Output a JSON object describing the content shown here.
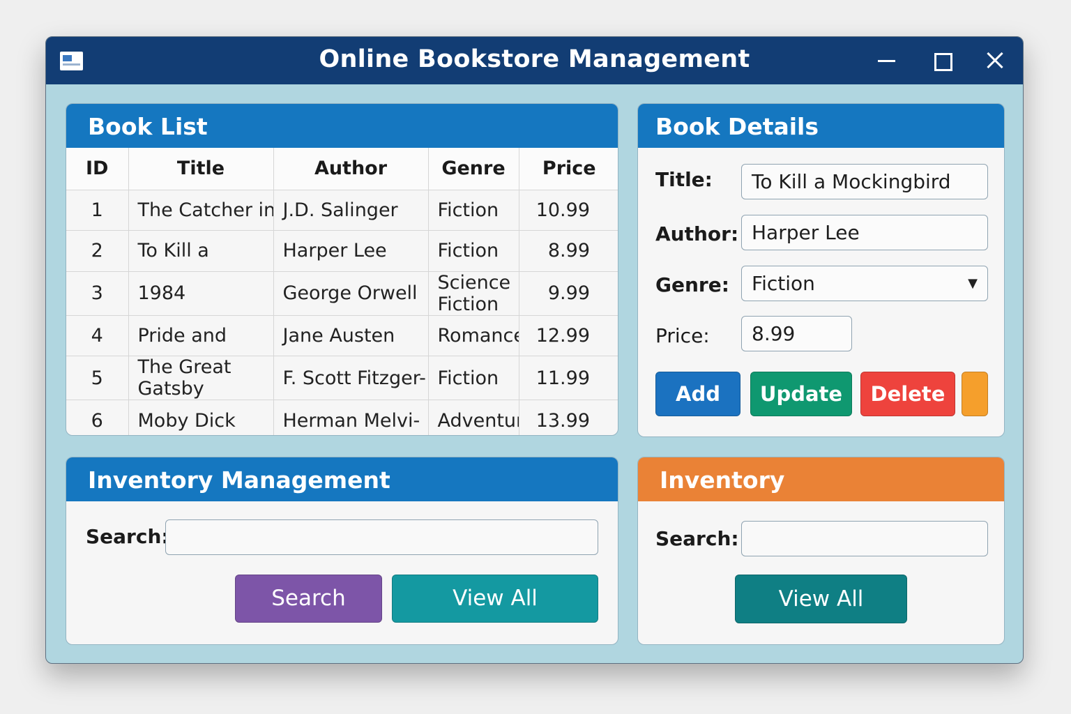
{
  "window": {
    "title": "Online Bookstore Management",
    "icons": {
      "app": "app-window-icon",
      "minimize": "minimize-icon",
      "maximize": "maximize-icon",
      "close": "close-icon"
    }
  },
  "book_list": {
    "header": "Book List",
    "columns": [
      "ID",
      "Title",
      "Author",
      "Genre",
      "Price"
    ],
    "rows": [
      {
        "id": "1",
        "title": "The Catcher in",
        "author": "J.D. Salinger",
        "genre": "Fiction",
        "price": "10.99"
      },
      {
        "id": "2",
        "title": "To Kill a",
        "author": "Harper Lee",
        "genre": "Fiction",
        "price": "8.99"
      },
      {
        "id": "3",
        "title": "1984",
        "author": "George Orwell",
        "genre": "Science Fiction",
        "price": "9.99"
      },
      {
        "id": "4",
        "title": "Pride and",
        "author": "Jane Austen",
        "genre": "Romance",
        "price": "12.99"
      },
      {
        "id": "5",
        "title": "The Great Gatsby",
        "author": "F. Scott Fitzger-",
        "genre": "Fiction",
        "price": "11.99"
      },
      {
        "id": "6",
        "title": "Moby Dick",
        "author": "Herman Melvi-",
        "genre": "Adventure",
        "price": "13.99"
      }
    ]
  },
  "book_details": {
    "header": "Book Details",
    "title_label": "Title:",
    "title_value": "To Kill a Mockingbird",
    "author_label": "Author:",
    "author_value": "Harper Lee",
    "genre_label": "Genre:",
    "genre_value": "Fiction",
    "genre_arrow": "▼",
    "price_label": "Price:",
    "price_value": "8.99",
    "add_label": "Add",
    "update_label": "Update",
    "delete_label": "Delete"
  },
  "inventory_management": {
    "header": "Inventory Management",
    "search_label": "Search:",
    "search_value": "",
    "search_button": "Search",
    "view_all_button": "View All"
  },
  "inventory": {
    "header": "Inventory",
    "search_label": "Search:",
    "search_value": "",
    "view_all_button": "View All"
  },
  "colors": {
    "titlebar": "#123d74",
    "panel_header_blue": "#1577c0",
    "panel_header_orange": "#ea8236",
    "window_bg": "#b0d6e0",
    "add": "#1b72c0",
    "update": "#0f9870",
    "delete": "#ee433d",
    "extra": "#f59f2c",
    "search": "#7d55a8",
    "view_all": "#1499a1",
    "view_all_inventory": "#0f7f84"
  }
}
